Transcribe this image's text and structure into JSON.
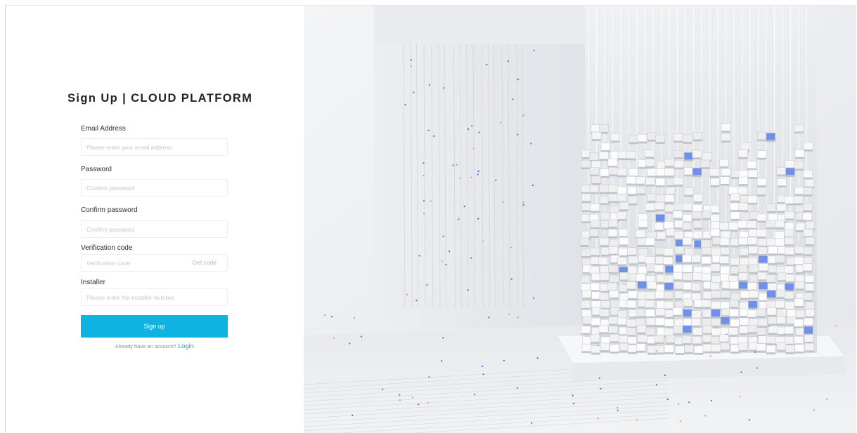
{
  "signup": {
    "title": "Sign Up | CLOUD PLATFORM",
    "email": {
      "label": "Email Address",
      "placeholder": "Please enter your email address."
    },
    "password": {
      "label": "Password",
      "placeholder": "Confirm password"
    },
    "confirm_password": {
      "label": "Confirm password",
      "placeholder": "Confirm password"
    },
    "verification": {
      "label": "Verification code",
      "placeholder": "Verification code",
      "get_code_label": "Get code"
    },
    "installer": {
      "label": "Installer",
      "placeholder": "Please enter the installer number."
    },
    "submit_label": "Sign up",
    "login_prompt": "Already have an account?",
    "login_link": "Login"
  },
  "colors": {
    "accent": "#0eb3e1",
    "link": "#1aa5d8",
    "title_text": "#1f2329"
  },
  "hero": {
    "image": "abstract-cube-tower-illustration"
  }
}
